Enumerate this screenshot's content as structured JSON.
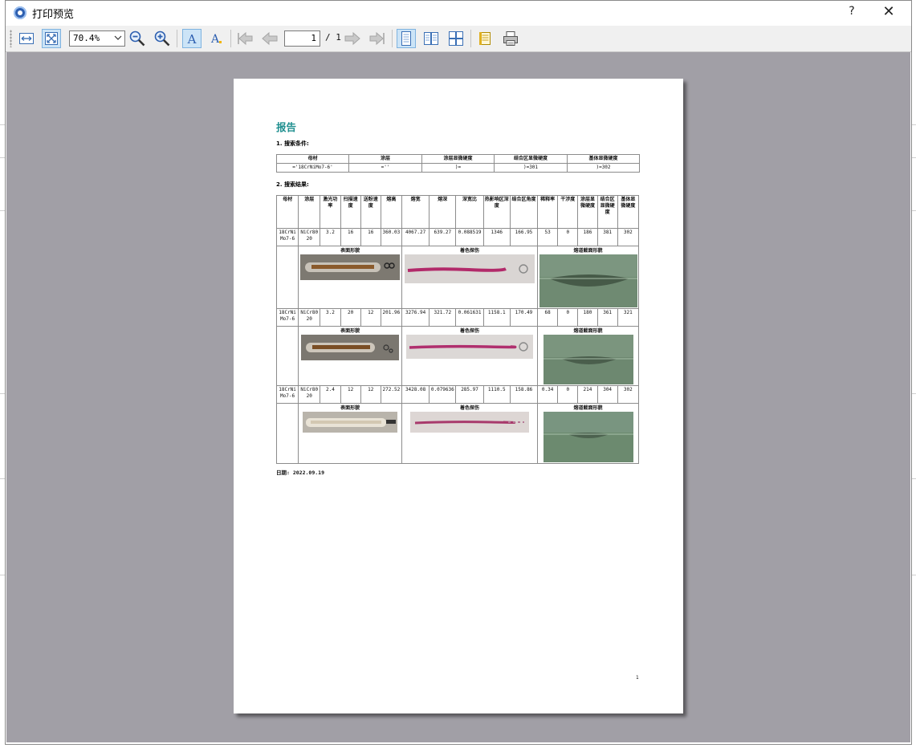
{
  "window": {
    "title": "打印预览",
    "help": "?",
    "close": "✕"
  },
  "toolbar": {
    "zoom_value": "70.4%",
    "page_current": "1",
    "page_total": "/ 1",
    "icons": [
      "fit-width-icon",
      "fit-page-icon",
      "zoom-out-icon",
      "zoom-in-icon",
      "text-antialias-icon",
      "text-normal-icon",
      "first-page-icon",
      "prev-page-icon",
      "next-page-icon",
      "last-page-icon",
      "single-page-icon",
      "two-page-icon",
      "four-page-icon",
      "page-setup-icon",
      "print-icon"
    ]
  },
  "report": {
    "title": "报告",
    "section1": "1. 搜索条件:",
    "criteria_headers": [
      "母材",
      "涂层",
      "涂层显微硬度",
      "结合区显微硬度",
      "基体显微硬度"
    ],
    "criteria_values": [
      "='18CrNiMo7-6'",
      "=''",
      ")=",
      ")=301",
      ")=302"
    ],
    "section2": "2. 搜索结果:",
    "result_headers": [
      "母材",
      "涂层",
      "激光功率",
      "扫描速度",
      "送粉速度",
      "熔高",
      "熔宽",
      "熔深",
      "深宽比",
      "热影响区深度",
      "结合区角度",
      "稀释率",
      "干涉度",
      "涂层显微硬度",
      "结合区显微硬度",
      "基体显微硬度"
    ],
    "image_captions": [
      "表面形貌",
      "着色探伤",
      "熔道截面形貌"
    ],
    "rows": [
      [
        "18CrNiMo7-6",
        "NiCr8020",
        "3.2",
        "16",
        "16",
        "360.03",
        "4067.27",
        "639.27",
        "0.088519",
        "1346",
        "166.95",
        "53",
        "0",
        "186",
        "381",
        "302"
      ],
      [
        "18CrNiMo7-6",
        "NiCr8020",
        "3.2",
        "20",
        "12",
        "201.96",
        "3276.94",
        "321.72",
        "0.061631",
        "1158.1",
        "170.49",
        "68",
        "0",
        "180",
        "361",
        "321"
      ],
      [
        "18CrNiMo7-6",
        "NiCr8020",
        "2.4",
        "12",
        "12",
        "272.52",
        "3428.08",
        "0.079636",
        "285.97",
        "1110.5",
        "158.86",
        "0.34",
        "0",
        "214",
        "304",
        "302"
      ]
    ],
    "date_label": "日期:",
    "date_value": "2022.09.19",
    "page_number": "1"
  },
  "colors": {
    "report_title": "#1f8f8f",
    "preview_bg": "#a19fa6",
    "toolbar_active": "#cce4f7"
  }
}
